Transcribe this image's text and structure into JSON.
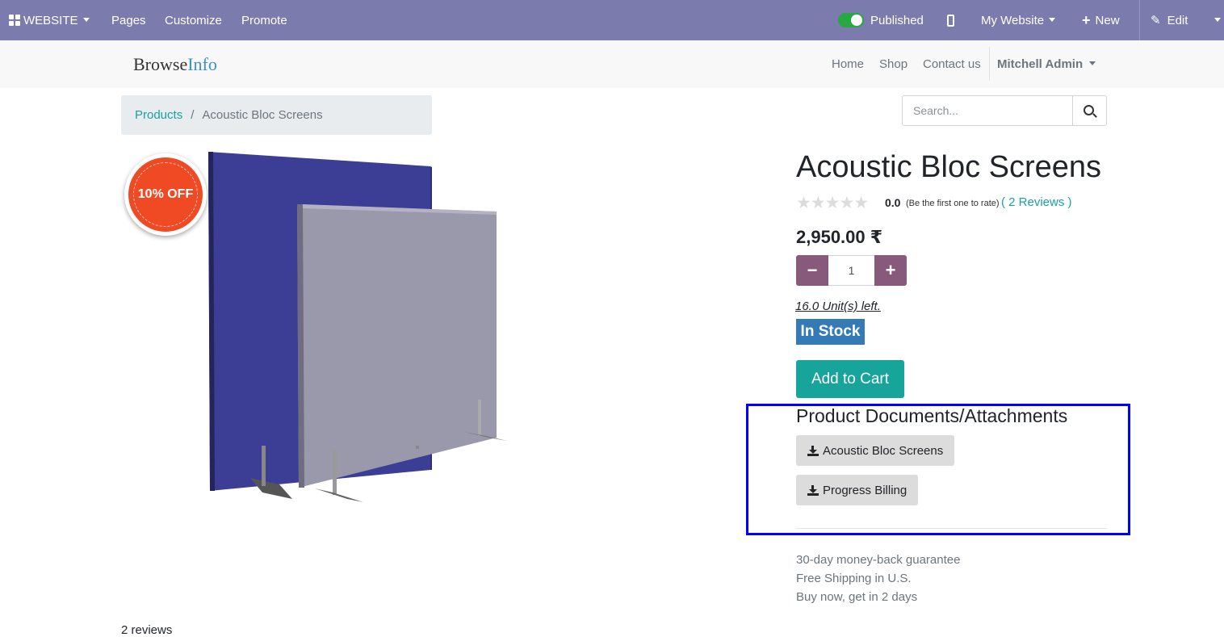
{
  "admin_bar": {
    "website_label": "WEBSITE",
    "pages_label": "Pages",
    "customize_label": "Customize",
    "promote_label": "Promote",
    "published_label": "Published",
    "my_website_label": "My Website",
    "new_label": "New",
    "edit_label": "Edit",
    "published": true
  },
  "header": {
    "logo_part1": "Browse",
    "logo_part2": "Info",
    "nav": [
      "Home",
      "Shop",
      "Contact us"
    ],
    "user_name": "Mitchell Admin"
  },
  "breadcrumb": {
    "parent": "Products",
    "separator": "/",
    "current": "Acoustic Bloc Screens"
  },
  "search": {
    "placeholder": "Search...",
    "value": ""
  },
  "product": {
    "image_badge": "10% OFF",
    "title": "Acoustic Bloc Screens",
    "stars": "★★★★★",
    "rating_value": "0.0",
    "rating_note": "(Be the first one to rate)",
    "reviews_link": "( 2 Reviews )",
    "price": "2,950.00 ₹",
    "quantity": "1",
    "units_left": "16.0 Unit(s) left.",
    "stock_status": "In Stock",
    "add_to_cart": "Add to Cart"
  },
  "documents": {
    "title": "Product Documents/Attachments",
    "items": [
      "Acoustic Bloc Screens",
      "Progress Billing"
    ]
  },
  "perks": [
    "30-day money-back guarantee",
    "Free Shipping in U.S.",
    "Buy now, get in 2 days"
  ],
  "reviews_count": "2 reviews",
  "colors": {
    "admin_bar": "#7c7bad",
    "accent_teal": "#17a2a0",
    "qty_button": "#875a7b",
    "in_stock": "#337ab7",
    "highlight": "#0000ff"
  }
}
